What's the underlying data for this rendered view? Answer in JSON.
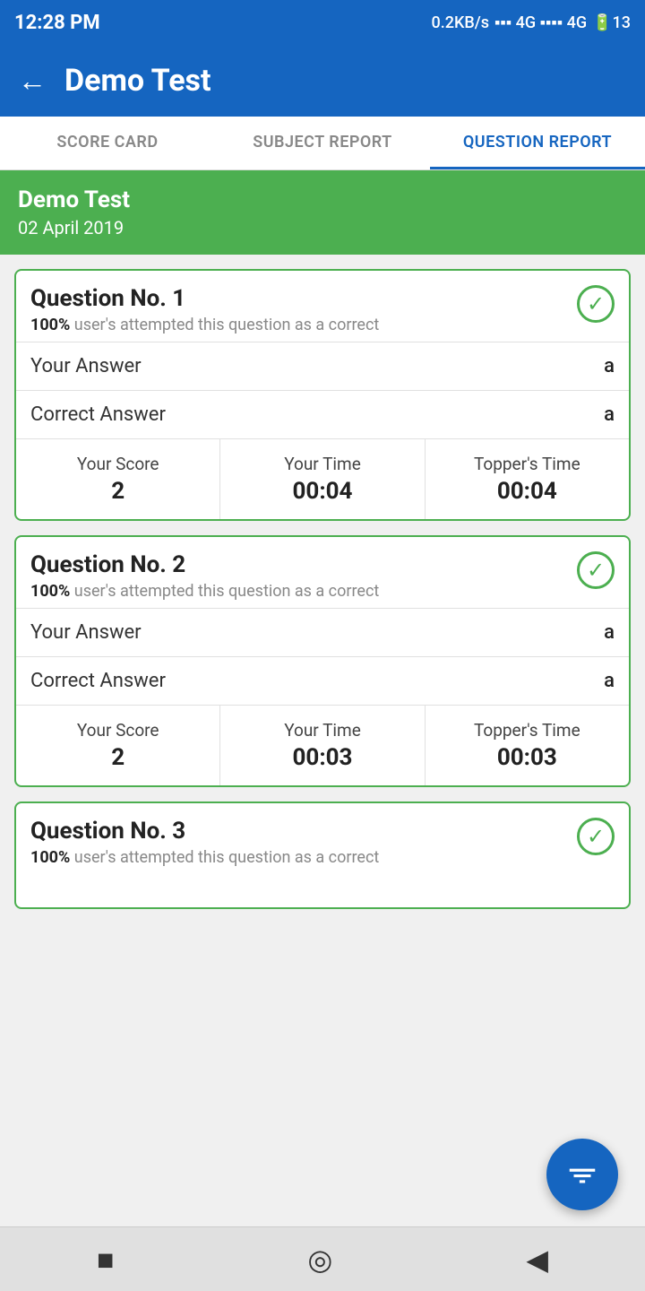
{
  "statusBar": {
    "time": "12:28 PM",
    "signal": "0.2KB/s",
    "network": "4G",
    "battery": "13"
  },
  "header": {
    "title": "Demo Test",
    "backLabel": "←"
  },
  "tabs": [
    {
      "id": "score-card",
      "label": "SCORE CARD",
      "active": false
    },
    {
      "id": "subject-report",
      "label": "SUBJECT REPORT",
      "active": false
    },
    {
      "id": "question-report",
      "label": "QUESTION REPORT",
      "active": true
    }
  ],
  "testBanner": {
    "name": "Demo Test",
    "date": "02 April 2019"
  },
  "questions": [
    {
      "no": "Question No. 1",
      "attemptPct": "100%",
      "attemptText": "user's attempted this question as a correct",
      "yourAnswer": "a",
      "correctAnswer": "a",
      "yourScore": "2",
      "yourTime": "00:04",
      "toppersTime": "00:04",
      "correct": true
    },
    {
      "no": "Question No. 2",
      "attemptPct": "100%",
      "attemptText": "user's attempted this question as a correct",
      "yourAnswer": "a",
      "correctAnswer": "a",
      "yourScore": "2",
      "yourTime": "00:03",
      "toppersTime": "00:03",
      "correct": true
    },
    {
      "no": "Question No. 3",
      "attemptPct": "100%",
      "attemptText": "user's attempted this question as a correct",
      "yourAnswer": "",
      "correctAnswer": "",
      "yourScore": "",
      "yourTime": "",
      "toppersTime": "",
      "correct": true
    }
  ],
  "labels": {
    "yourAnswer": "Your Answer",
    "correctAnswer": "Correct Answer",
    "yourScore": "Your Score",
    "yourTime": "Your Time",
    "toppersTime": "Topper's Time"
  },
  "fab": {
    "icon": "▼",
    "label": "filter"
  },
  "bottomNav": {
    "square": "■",
    "circle": "◎",
    "triangle": "◀"
  }
}
